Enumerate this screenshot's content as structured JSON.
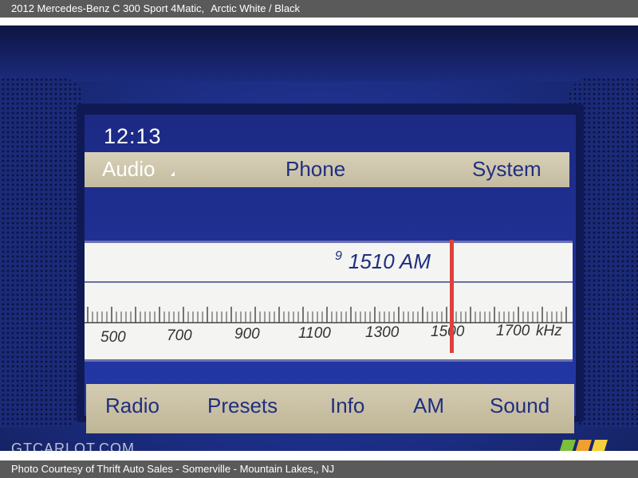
{
  "caption": {
    "vehicle": "2012 Mercedes-Benz C 300 Sport 4Matic,",
    "color": "Arctic White / Black",
    "credit": "Photo Courtesy of Thrift Auto Sales - Somerville - Mountain Lakes,, NJ",
    "watermark": "GTCARLOT.COM"
  },
  "display": {
    "clock": "12:13",
    "top_menu": [
      "Audio",
      "Phone",
      "System"
    ],
    "preset_number": "9",
    "frequency": "1510 AM",
    "scale_labels": [
      "500",
      "700",
      "900",
      "1100",
      "1300",
      "1500",
      "1700"
    ],
    "scale_unit": "kHz",
    "tuned_khz": 1510,
    "bottom_menu": [
      "Radio",
      "Presets",
      "Info",
      "AM",
      "Sound"
    ]
  },
  "colors": {
    "panel_blue": "#1f2f80",
    "needle": "#e0403a"
  }
}
